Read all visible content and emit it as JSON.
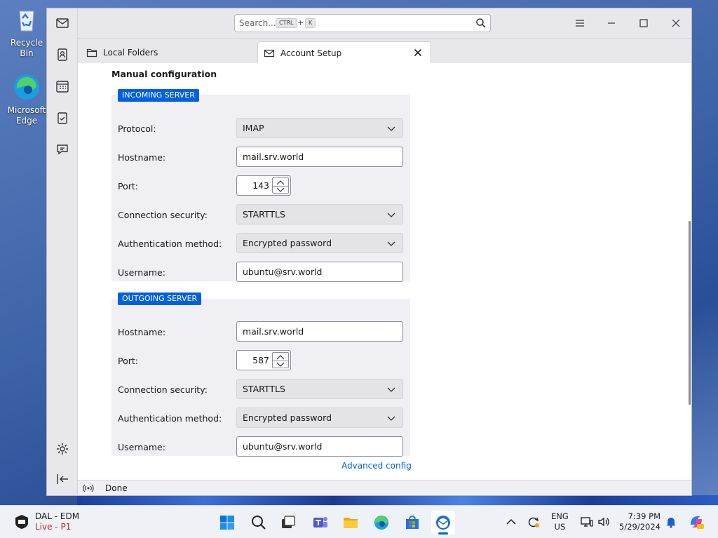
{
  "desktop": {
    "recycle_bin_label": "Recycle Bin",
    "edge_label": "Microsoft Edge"
  },
  "window": {
    "search": {
      "placeholder": "Search...",
      "key_ctrl": "CTRL",
      "key_plus": "+",
      "key_k": "K"
    },
    "tabs": [
      {
        "label": "Local Folders",
        "icon": "folder-icon"
      },
      {
        "label": "Account Setup",
        "icon": "mail-envelope-icon",
        "active": true
      }
    ],
    "spaces": [
      "mail-icon",
      "address-book-icon",
      "calendar-icon",
      "tasks-icon",
      "chat-icon",
      "settings-icon",
      "collapse-icon"
    ]
  },
  "form": {
    "title": "Manual configuration",
    "incoming": {
      "heading": "INCOMING SERVER",
      "protocol_label": "Protocol:",
      "protocol_value": "IMAP",
      "hostname_label": "Hostname:",
      "hostname_value": "mail.srv.world",
      "port_label": "Port:",
      "port_value": "143",
      "security_label": "Connection security:",
      "security_value": "STARTTLS",
      "auth_label": "Authentication method:",
      "auth_value": "Encrypted password",
      "username_label": "Username:",
      "username_value": "ubuntu@srv.world"
    },
    "outgoing": {
      "heading": "OUTGOING SERVER",
      "hostname_label": "Hostname:",
      "hostname_value": "mail.srv.world",
      "port_label": "Port:",
      "port_value": "587",
      "security_label": "Connection security:",
      "security_value": "STARTTLS",
      "auth_label": "Authentication method:",
      "auth_value": "Encrypted password",
      "username_label": "Username:",
      "username_value": "ubuntu@srv.world"
    },
    "advanced_link": "Advanced config"
  },
  "status": {
    "text": "Done"
  },
  "taskbar": {
    "news_line1": "DAL - EDM",
    "news_line2": "Live - P1",
    "lang_line1": "ENG",
    "lang_line2": "US",
    "time": "7:39 PM",
    "date": "5/29/2024"
  },
  "colors": {
    "accent": "#0060df",
    "live": "#c42b1c"
  }
}
